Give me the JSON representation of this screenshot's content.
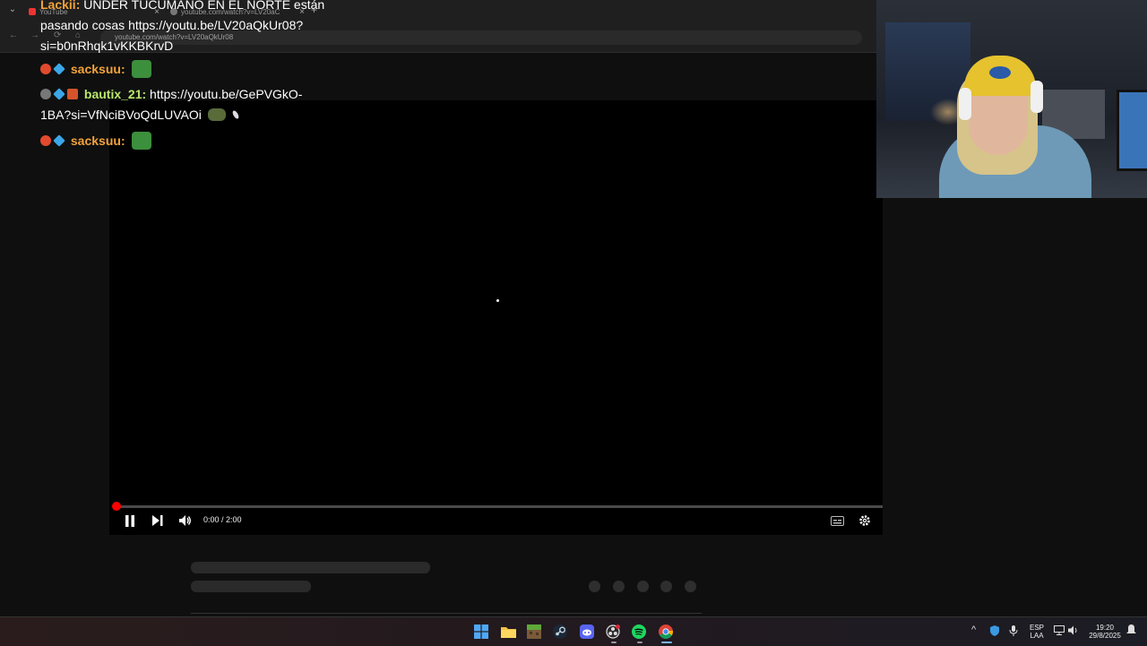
{
  "browser": {
    "tabs": [
      {
        "title": "YouTube",
        "close": "×"
      },
      {
        "title": "youtube.com/watch?v=LV20aC",
        "close": "×"
      }
    ],
    "new_tab": "+",
    "menu": "⌄",
    "address": "youtube.com/watch?v=LV20aQkUr08"
  },
  "chat": {
    "messages": [
      {
        "user": "Lackii",
        "text": "UNDER TUCUMANO EN EL NORTE están"
      },
      {
        "user": "",
        "text": "pasando cosas https://youtu.be/LV20aQkUr08?"
      },
      {
        "user": "",
        "text": "si=b0nRhqk1vKKBKrvD"
      },
      {
        "user": "sacksuu",
        "text": ""
      },
      {
        "user": "bautix_21",
        "text": "https://youtu.be/GePVGkO-"
      },
      {
        "user": "",
        "text": "1BA?si=VfNciBVoQdLUVAOi"
      },
      {
        "user": "sacksuu",
        "text": ""
      }
    ],
    "separator": ":"
  },
  "player": {
    "time": "0:00 / 2:00",
    "progress": 0,
    "icons": {
      "play_pause": "pause-icon",
      "next": "next-icon",
      "volume": "volume-icon",
      "subtitles": "subtitles-icon",
      "settings": "gear-icon"
    },
    "accent": "#ff0000"
  },
  "taskbar": {
    "apps": [
      "windows-start",
      "file-explorer",
      "minecraft",
      "steam",
      "discord",
      "obs",
      "spotify",
      "chrome"
    ],
    "tray": {
      "lang_top": "ESP",
      "lang_bottom": "LAA",
      "time": "19:20",
      "date": "29/8/2025",
      "chevron": "^"
    }
  }
}
